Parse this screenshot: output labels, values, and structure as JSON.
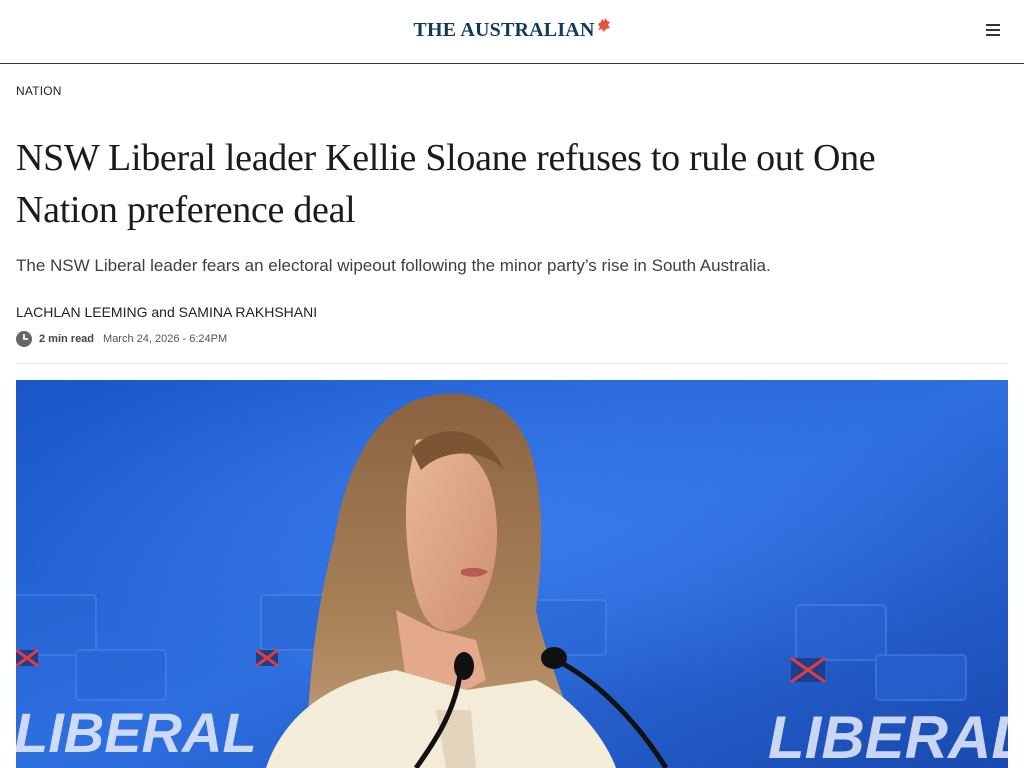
{
  "masthead": {
    "logo_text": "THE AUSTRALIAN",
    "logo_color": "#0f3a5c",
    "accent_color": "#e5533d",
    "logo_mark_icon": "flame-icon",
    "menu_icon": "hamburger-menu-icon"
  },
  "article": {
    "section": "NATION",
    "headline": "NSW Liberal leader Kellie Sloane refuses to rule out One Nation preference deal",
    "standfirst": "The NSW Liberal leader fears an electoral wipeout following the minor party’s rise in South Australia.",
    "authors": [
      "LACHLAN LEEMING",
      "SAMINA RAKHSHANI"
    ],
    "author_joiner": "and",
    "read_time": "2 min read",
    "published": "March 24, 2026 - 6:24PM",
    "read_time_icon": "clock-icon"
  },
  "hero_image": {
    "backdrop_text": "LIBERAL",
    "backdrop_color": "#1f5fd0"
  }
}
